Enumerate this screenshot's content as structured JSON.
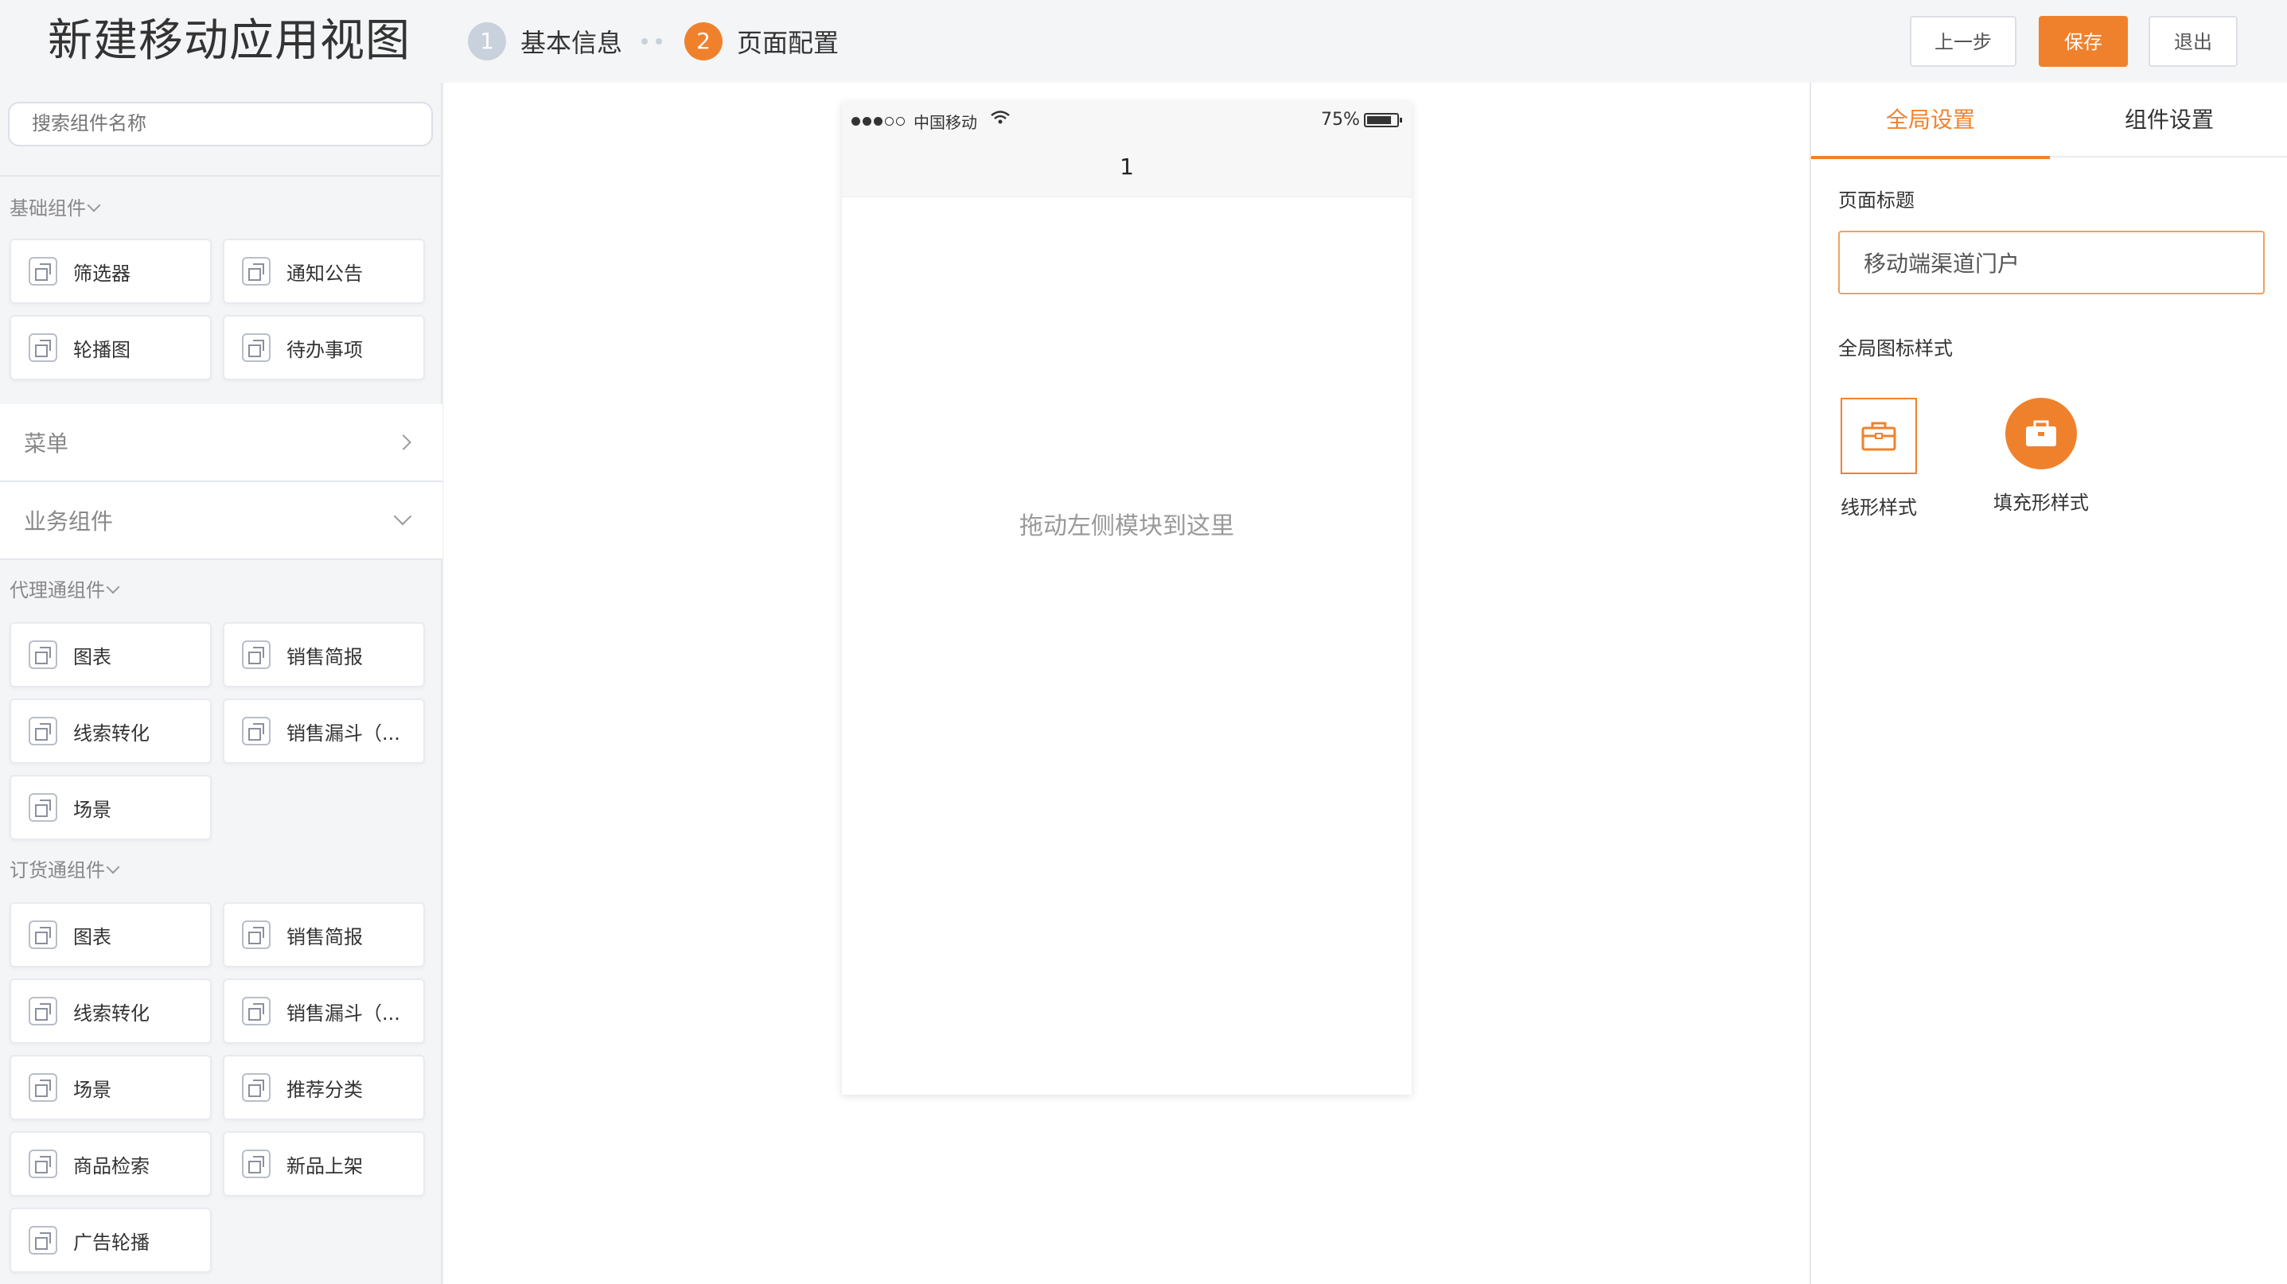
{
  "header": {
    "title": "新建移动应用视图",
    "steps": [
      {
        "num": "1",
        "label": "基本信息"
      },
      {
        "num": "2",
        "label": "页面配置"
      }
    ],
    "buttons": {
      "prev": "上一步",
      "save": "保存",
      "exit": "退出"
    }
  },
  "left_panel": {
    "search_placeholder": "搜索组件名称",
    "basic_group": {
      "title": "基础组件",
      "items": [
        "筛选器",
        "通知公告",
        "轮播图",
        "待办事项"
      ]
    },
    "menu_section": "菜单",
    "business_section": "业务组件",
    "agent_group": {
      "title": "代理通组件",
      "items": [
        "图表",
        "销售简报",
        "线索转化",
        "销售漏斗（...",
        "场景"
      ]
    },
    "order_group": {
      "title": "订货通组件",
      "items": [
        "图表",
        "销售简报",
        "线索转化",
        "销售漏斗（...",
        "场景",
        "推荐分类",
        "商品检索",
        "新品上架",
        "广告轮播"
      ]
    }
  },
  "phone": {
    "carrier": "中国移动",
    "battery": "75%",
    "nav_title": "1",
    "drop_hint": "拖动左侧模块到这里"
  },
  "right_panel": {
    "tabs": [
      "全局设置",
      "组件设置"
    ],
    "page_title_label": "页面标题",
    "page_title_value": "移动端渠道门户",
    "icon_style_label": "全局图标样式",
    "icon_styles": [
      "线形样式",
      "填充形样式"
    ]
  },
  "colors": {
    "accent": "#f0812c",
    "step_inactive": "#c9d1dc"
  }
}
